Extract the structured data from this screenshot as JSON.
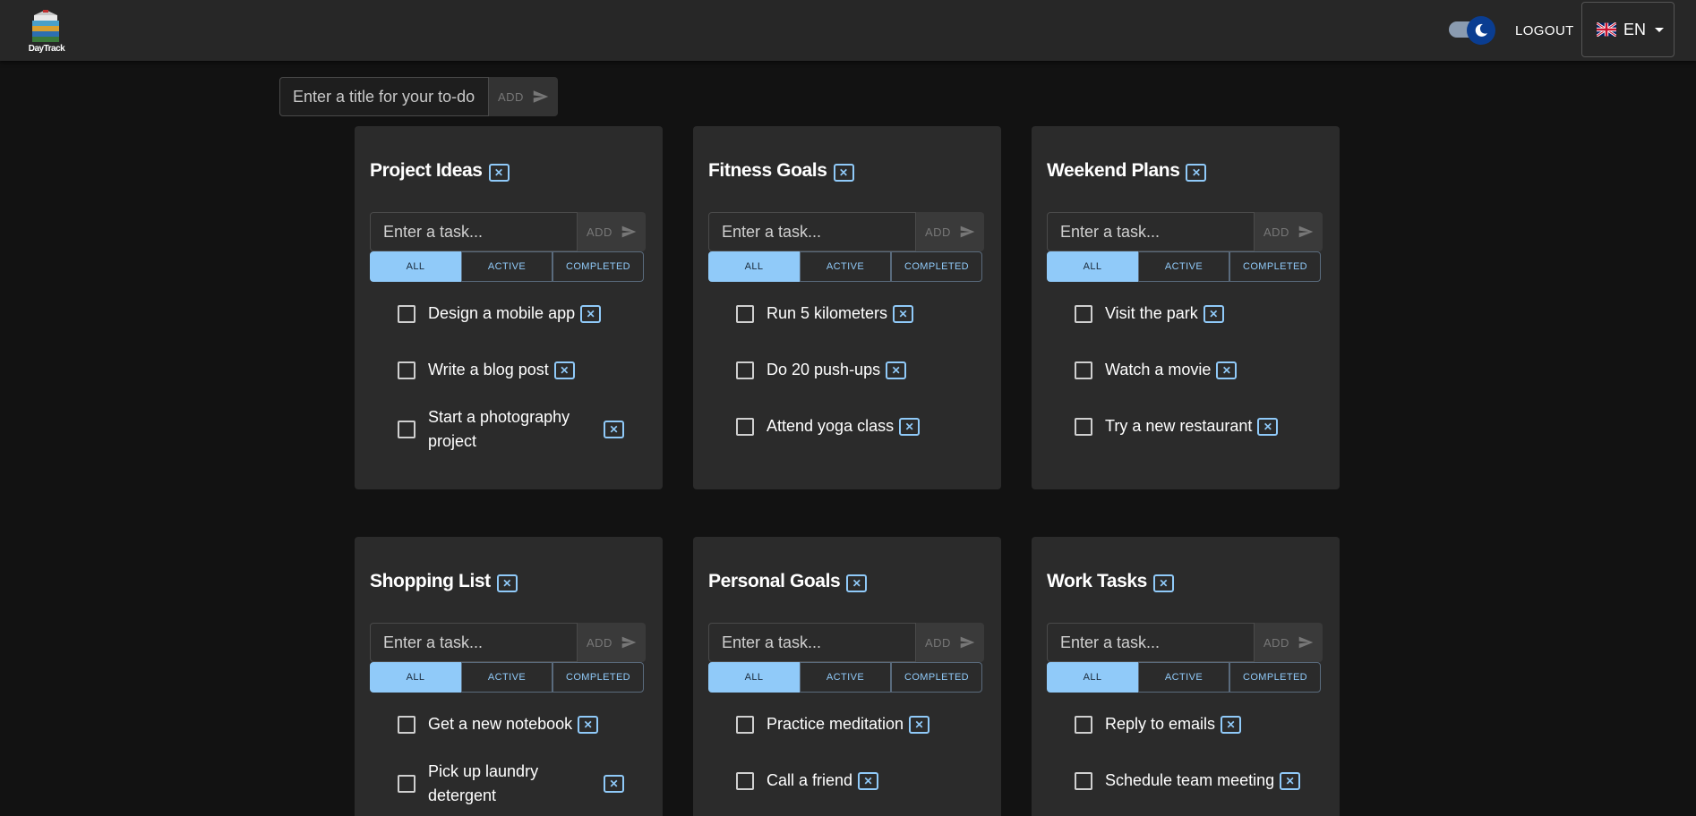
{
  "app": {
    "logo_text": "DayTrack"
  },
  "header": {
    "logout_label": "LOGOUT",
    "language": "EN"
  },
  "new_list": {
    "placeholder": "Enter a title for your to-do list...",
    "add_label": "ADD"
  },
  "task_input": {
    "placeholder": "Enter a task...",
    "add_label": "ADD"
  },
  "filters": {
    "all": "ALL",
    "active": "ACTIVE",
    "completed": "COMPLETED"
  },
  "close_glyph": "✕",
  "lists": [
    {
      "title": "Project Ideas",
      "tasks": [
        "Design a mobile app",
        "Write a blog post",
        "Start a photography project"
      ]
    },
    {
      "title": "Fitness Goals",
      "tasks": [
        "Run 5 kilometers",
        "Do 20 push-ups",
        "Attend yoga class"
      ]
    },
    {
      "title": "Weekend Plans",
      "tasks": [
        "Visit the park",
        "Watch a movie",
        "Try a new restaurant"
      ]
    },
    {
      "title": "Shopping List",
      "tasks": [
        "Get a new notebook",
        "Pick up laundry detergent"
      ]
    },
    {
      "title": "Personal Goals",
      "tasks": [
        "Practice meditation",
        "Call a friend"
      ]
    },
    {
      "title": "Work Tasks",
      "tasks": [
        "Reply to emails",
        "Schedule team meeting"
      ]
    }
  ],
  "colors": {
    "accent": "#90caf9",
    "background": "#121212",
    "card": "#2b2b2b",
    "appbar": "#272727"
  }
}
